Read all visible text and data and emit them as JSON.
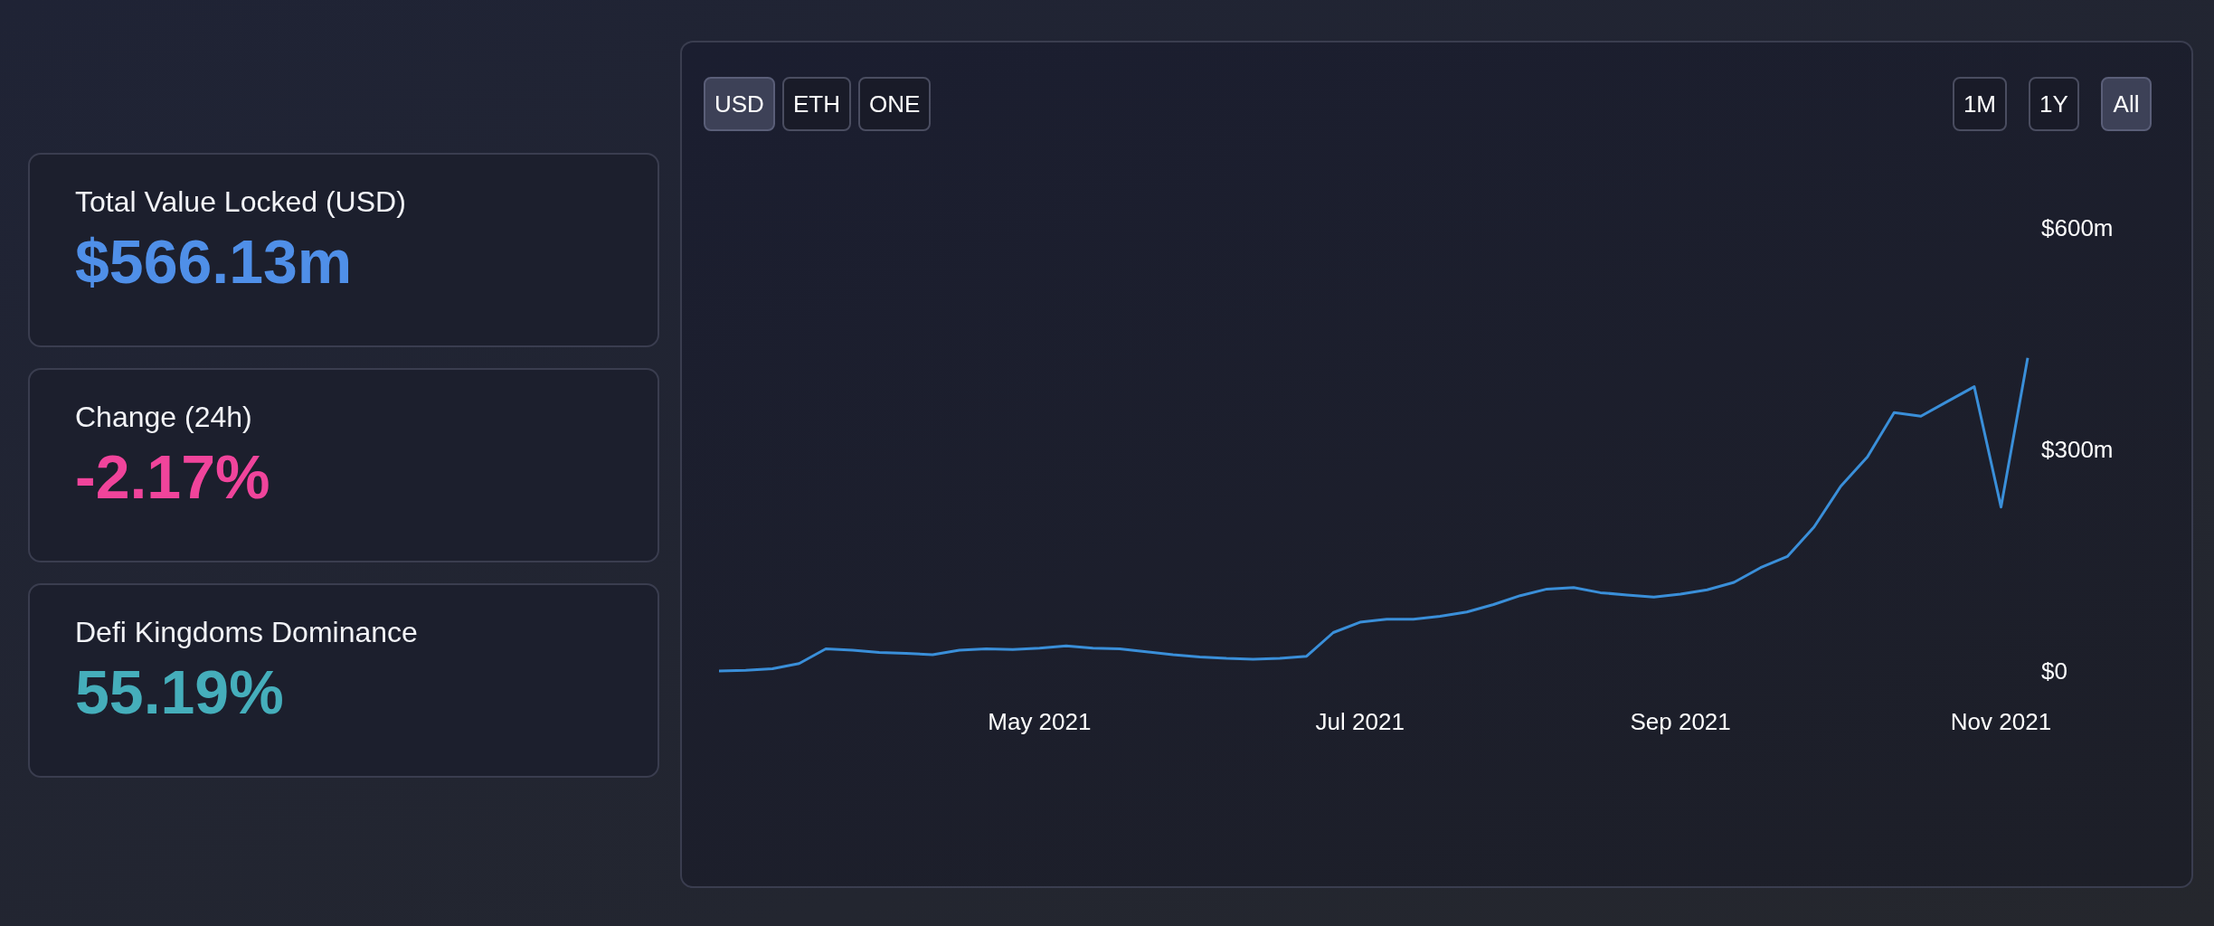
{
  "stats": [
    {
      "label": "Total Value Locked (USD)",
      "value": "$566.13m",
      "color": "#4f8fe8"
    },
    {
      "label": "Change (24h)",
      "value": "-2.17%",
      "color": "#f0449b"
    },
    {
      "label": "Defi Kingdoms Dominance",
      "value": "55.19%",
      "color": "#45aebb"
    }
  ],
  "currency_buttons": [
    {
      "label": "USD",
      "selected": true
    },
    {
      "label": "ETH",
      "selected": false
    },
    {
      "label": "ONE",
      "selected": false
    }
  ],
  "range_buttons": [
    {
      "label": "1M",
      "selected": false
    },
    {
      "label": "1Y",
      "selected": false
    },
    {
      "label": "All",
      "selected": true
    }
  ],
  "chart": {
    "chart_data": {
      "type": "line",
      "categories": [
        null,
        null,
        null,
        null,
        null,
        null,
        null,
        null,
        null,
        null,
        null,
        null,
        "May 2021",
        null,
        null,
        null,
        null,
        null,
        null,
        null,
        null,
        null,
        null,
        null,
        "Jul 2021",
        null,
        null,
        null,
        null,
        null,
        null,
        null,
        null,
        null,
        null,
        null,
        "Sep 2021",
        null,
        null,
        null,
        null,
        null,
        null,
        null,
        null,
        null,
        null,
        null,
        "Nov 2021",
        null
      ],
      "series": [
        {
          "color": "#3a8fd9",
          "values": [
            0,
            1,
            3,
            10,
            30,
            28,
            25,
            24,
            22,
            28,
            30,
            29,
            31,
            34,
            31,
            30,
            26,
            22,
            19,
            17,
            16,
            17,
            20,
            52,
            66,
            70,
            70,
            74,
            80,
            90,
            102,
            111,
            113,
            106,
            103,
            100,
            104,
            110,
            120,
            140,
            155,
            195,
            250,
            290,
            350,
            345,
            365,
            385,
            222,
            424
          ]
        }
      ],
      "ylim": [
        0,
        600
      ],
      "yticks": [
        {
          "value": 0,
          "label": "$0"
        },
        {
          "value": 300,
          "label": "$300m"
        },
        {
          "value": 600,
          "label": "$600m"
        }
      ]
    }
  }
}
